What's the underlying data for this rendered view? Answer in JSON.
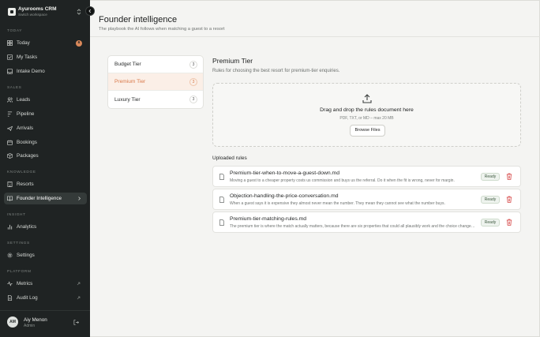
{
  "sidebar": {
    "brand": {
      "name": "Ayurooms CRM",
      "subtitle": "Switch workspace"
    },
    "sections": {
      "today": "TODAY",
      "sales": "SALES",
      "knowledge": "KNOWLEDGE",
      "insight": "INSIGHT",
      "settings": "SETTINGS",
      "platform": "PLATFORM"
    },
    "items": {
      "today": {
        "label": "Today",
        "badge": "6",
        "icon": "grid-icon"
      },
      "my_tasks": {
        "label": "My Tasks",
        "icon": "checklist-icon"
      },
      "intake_demo": {
        "label": "Intake Demo",
        "icon": "inbox-icon"
      },
      "leads": {
        "label": "Leads",
        "icon": "users-icon"
      },
      "pipeline": {
        "label": "Pipeline",
        "icon": "pipeline-icon"
      },
      "arrivals": {
        "label": "Arrivals",
        "icon": "plane-icon"
      },
      "bookings": {
        "label": "Bookings",
        "icon": "calendar-icon"
      },
      "packages": {
        "label": "Packages",
        "icon": "package-icon"
      },
      "resorts": {
        "label": "Resorts",
        "icon": "building-icon"
      },
      "founder_intelligence": {
        "label": "Founder Intelligence",
        "icon": "book-icon"
      },
      "analytics": {
        "label": "Analytics",
        "icon": "bar-chart-icon"
      },
      "settings": {
        "label": "Settings",
        "icon": "gear-icon"
      },
      "metrics": {
        "label": "Metrics",
        "icon": "activity-icon"
      },
      "audit_log": {
        "label": "Audit Log",
        "icon": "file-icon"
      }
    },
    "user": {
      "initials": "AM",
      "name": "Aiy Menon",
      "role": "Admin"
    }
  },
  "header": {
    "title": "Founder intelligence",
    "subtitle": "The playbook the AI follows when matching a guest to a resort"
  },
  "tiers": [
    {
      "label": "Budget Tier",
      "count": "3"
    },
    {
      "label": "Premium Tier",
      "count": "3"
    },
    {
      "label": "Luxury Tier",
      "count": "3"
    }
  ],
  "detail": {
    "title": "Premium Tier",
    "subtitle": "Rules for choosing the best resort for premium-tier enquiries.",
    "dropzone": {
      "title": "Drag and drop the rules document here",
      "hint": "PDF, TXT, or MD – max 20 MB",
      "button": "Browse Files"
    },
    "uploaded_heading": "Uploaded rules",
    "rules": [
      {
        "name": "Premium-tier-when-to-move-a-guest-down.md",
        "preview": "Moving a guest to a cheaper property costs us commission and buys us the referral. Do it when the fit is wrong, never for margin.",
        "status": "Ready"
      },
      {
        "name": "Objection-handling-the-price-conversation.md",
        "preview": "When a guest says it is expensive they almost never mean the number. They mean they cannot see what the number buys.",
        "status": "Ready"
      },
      {
        "name": "Premium-tier-matching-rules.md",
        "preview": "The premium tier is where the match actually matters, because there are six properties that could all plausibly work and the choice changes everything.",
        "status": "Ready"
      }
    ]
  },
  "colors": {
    "sidebar_bg": "#1f2323",
    "accent": "#d9794a",
    "ready_badge": "#3f5a40",
    "delete": "#d64545"
  }
}
